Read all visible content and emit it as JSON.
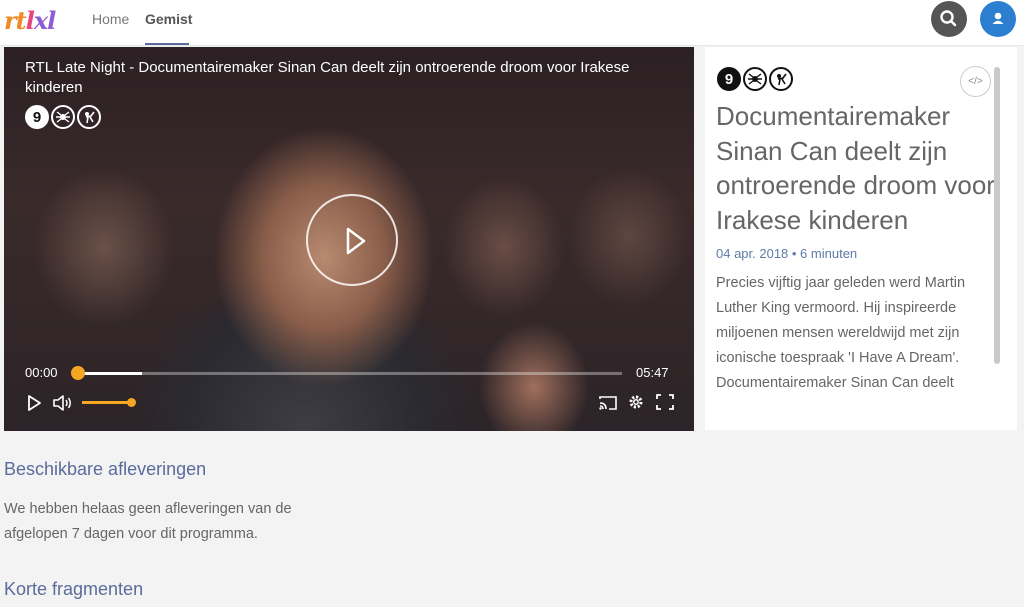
{
  "header": {
    "logo": {
      "part1": "rt",
      "part2": "l",
      "part3": "xl"
    },
    "nav": [
      {
        "label": "Home"
      },
      {
        "label": "Gemist"
      }
    ],
    "active_nav": "Gemist"
  },
  "player": {
    "title": "RTL Late Night - Documentairemaker Sinan Can deelt zijn ontroerende droom voor Irakese kinderen",
    "ratings": [
      "9",
      "fear-icon",
      "violence-icon"
    ],
    "current_time": "00:00",
    "duration": "05:47",
    "buffered_fraction": 0.12,
    "volume_fraction": 1.0
  },
  "info": {
    "ratings": [
      "9",
      "fear-icon",
      "violence-icon"
    ],
    "embed_label": "</>",
    "title": "Documentairemaker Sinan Can deelt zijn ontroerende droom voor Irakese kinderen",
    "meta": "04 apr. 2018 • 6 minuten",
    "description": "Precies vijftig jaar geleden werd Martin Luther King vermoord. Hij inspireerde miljoenen mensen wereldwijd met zijn iconische toespraak 'I Have A Dream'. Documentairemaker Sinan Can deelt"
  },
  "sections": {
    "available": {
      "title": "Beschikbare afleveringen",
      "text": "We hebben helaas geen afleveringen van de afgelopen 7 dagen voor dit programma."
    },
    "fragments": {
      "title": "Korte fragmenten"
    }
  },
  "colors": {
    "accent": "#f5a623",
    "link": "#5a6b9c",
    "user": "#2c7fd0"
  }
}
